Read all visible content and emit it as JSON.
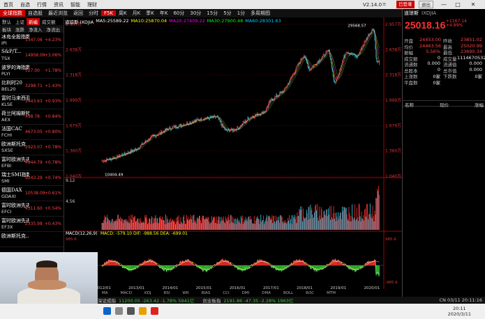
{
  "titlebar": {
    "nav": [
      "首页",
      "自选",
      "行情",
      "资讯",
      "智能",
      "理财"
    ],
    "version": "V2.14.0",
    "logged_out": "已登录",
    "close_btn": "退出",
    "menu": "≡",
    "minimize": "—",
    "maximize": "□",
    "close": "✕"
  },
  "toolbar": {
    "items": [
      "全球指数",
      "自选股",
      "最近浏览",
      "返回",
      "分时",
      "F5K",
      "周K",
      "月K",
      "季K",
      "年K",
      "60分",
      "30分",
      "15分",
      "5分",
      "1分",
      "多周期图"
    ],
    "active_index": 5
  },
  "left_panel": {
    "tabs": [
      "默认",
      "上证",
      "新编",
      "成交额"
    ],
    "active_tab": 0,
    "subtabs": [
      "板块",
      "涨跌",
      "净流入",
      "净流出"
    ],
    "indices": [
      {
        "name": "冰岛全股指数",
        "code": "IPI",
        "price": "1347.06",
        "change": "+4.23%"
      },
      {
        "name": "S&P/T...",
        "code": "TSX",
        "price": "14958.09",
        "change": "+3.06%"
      },
      {
        "name": "波罗的海指数",
        "code": "PLYI",
        "price": "527.00",
        "change": "+1.78%"
      },
      {
        "name": "比利时20",
        "code": "BEL20",
        "price": "3298.71",
        "change": "+1.43%"
      },
      {
        "name": "富时马来西亚",
        "code": "KLSE",
        "price": "1443.63",
        "change": "+0.93%"
      },
      {
        "name": "荷兰阿姆斯特丹",
        "code": "AEX",
        "price": "498.78",
        "change": "+0.84%"
      },
      {
        "name": "法国CAC",
        "code": "FCHI",
        "price": "4673.05",
        "change": "+0.80%"
      },
      {
        "name": "欧洲斯托克",
        "code": "SX5E",
        "price": "2923.07",
        "change": "+0.78%"
      },
      {
        "name": "富时欧洲先进",
        "code": "EFBI",
        "price": "4944.79",
        "change": "+0.78%"
      },
      {
        "name": "瑞士SMI指数",
        "code": "SMI",
        "price": "9243.29",
        "change": "+0.74%"
      },
      {
        "name": "德国DAX",
        "code": "GDAXI",
        "price": "10538.09",
        "change": "+0.61%"
      },
      {
        "name": "富时欧洲先进",
        "code": "EFCI",
        "price": "4311.60",
        "change": "+0.54%"
      },
      {
        "name": "富时欧洲先进",
        "code": "EF3X",
        "price": "2335.98",
        "change": "+0.43%"
      },
      {
        "name": "欧洲斯托克...",
        "code": "",
        "price": "",
        "change": ""
      }
    ]
  },
  "chart_legend": {
    "name": "道琼斯 IXDJIA",
    "ma5": "MA5:25589.22",
    "ma10": "MA10:25870.04",
    "ma20": "MA20:27409.22",
    "ma30": "MA30:27900.48",
    "ma60": "MA60:28301.63"
  },
  "chart_data": {
    "type": "candlestick-line",
    "title": "道琼斯 IXDJIA 周K",
    "price_ticks": [
      "2.957万",
      "2.638万",
      "2.318万",
      "1.999万",
      "1.679万",
      "1.360万",
      "1.040万"
    ],
    "right_price_ticks": [
      "2.957万",
      "2.638万",
      "2.318万",
      "1.999万",
      "1.679万",
      "1.360万",
      "1.040万"
    ],
    "high_label": "29568.57",
    "low_label": "10404.49",
    "volume_ticks": [
      "9.12",
      "4.56"
    ],
    "macd_label": "MACD(12,26,9)",
    "macd_values": "MACD: -579.10  DIF: -988.56  DEA: -699.01",
    "macd_ticks": [
      "985.6",
      "-985.6"
    ],
    "x_labels": [
      "2012/01",
      "2013/01",
      "2014/01",
      "2015/01",
      "2016/01",
      "2017/01",
      "2018/01",
      "2019/01",
      "2020/01"
    ],
    "series": [
      {
        "x": "2012/01",
        "y": 12000
      },
      {
        "x": "2012/06",
        "y": 12500
      },
      {
        "x": "2013/01",
        "y": 13500
      },
      {
        "x": "2013/06",
        "y": 15000
      },
      {
        "x": "2014/01",
        "y": 16300
      },
      {
        "x": "2014/06",
        "y": 16800
      },
      {
        "x": "2015/01",
        "y": 17600
      },
      {
        "x": "2015/06",
        "y": 17800
      },
      {
        "x": "2015/09",
        "y": 16000
      },
      {
        "x": "2016/01",
        "y": 16200
      },
      {
        "x": "2016/06",
        "y": 17800
      },
      {
        "x": "2016/11",
        "y": 18500
      },
      {
        "x": "2017/01",
        "y": 19900
      },
      {
        "x": "2017/06",
        "y": 21300
      },
      {
        "x": "2018/01",
        "y": 26000
      },
      {
        "x": "2018/03",
        "y": 24000
      },
      {
        "x": "2018/10",
        "y": 26600
      },
      {
        "x": "2018/12",
        "y": 22000
      },
      {
        "x": "2019/04",
        "y": 26500
      },
      {
        "x": "2019/08",
        "y": 25700
      },
      {
        "x": "2019/12",
        "y": 28600
      },
      {
        "x": "2020/02",
        "y": 29568
      },
      {
        "x": "2020/03",
        "y": 25018
      }
    ],
    "ylim": [
      10000,
      30000
    ]
  },
  "indicator_tabs": [
    "MA",
    "MACD",
    "KDJ",
    "RSI",
    "WR",
    "BIAS",
    "CCI",
    "DMI",
    "DMA",
    "BOLL",
    "ROC",
    "MTM"
  ],
  "right_panel": {
    "stock_name": "道琼斯",
    "stock_code": "IXDJIA",
    "price": "25018.16",
    "change": "+1167.14",
    "change_pct": "+4.89%",
    "rows": [
      {
        "k": "开盘",
        "v": "24453.00",
        "k2": "昨收",
        "v2": "23851.02"
      },
      {
        "k": "均价",
        "v": "24463.56",
        "k2": "最高",
        "v2": "25020.99"
      },
      {
        "k": "振幅",
        "v": "5.56%",
        "k2": "最低",
        "v2": "23690.34"
      },
      {
        "k": "成交额",
        "v": "0",
        "k2": "成交量",
        "v2": "1114670532"
      },
      {
        "k": "流通数",
        "v": "0.000",
        "k2": "流通值",
        "v2": "0.000"
      },
      {
        "k": "总股本",
        "v": "0",
        "k2": "总市值",
        "v2": "0.000"
      },
      {
        "k": "上涨数",
        "v": "0家",
        "k2": "下跌数",
        "v2": "0家"
      },
      {
        "k": "平盘数",
        "v": "0家",
        "k2": "",
        "v2": ""
      }
    ],
    "list_head": [
      "名称",
      "现价",
      "涨幅"
    ]
  },
  "bottombar": {
    "sz_label": "深证成指",
    "sz_value": "11200.05 -263.42 -1.78% 5941亿",
    "cy_label": "创业板指",
    "cy_value": "2191.86 -47.35 -2.28% 1963亿",
    "datetime": "CN 03/11 20:11:16"
  },
  "taskbar": {
    "time": "20:11",
    "date": "2020/3/11"
  }
}
